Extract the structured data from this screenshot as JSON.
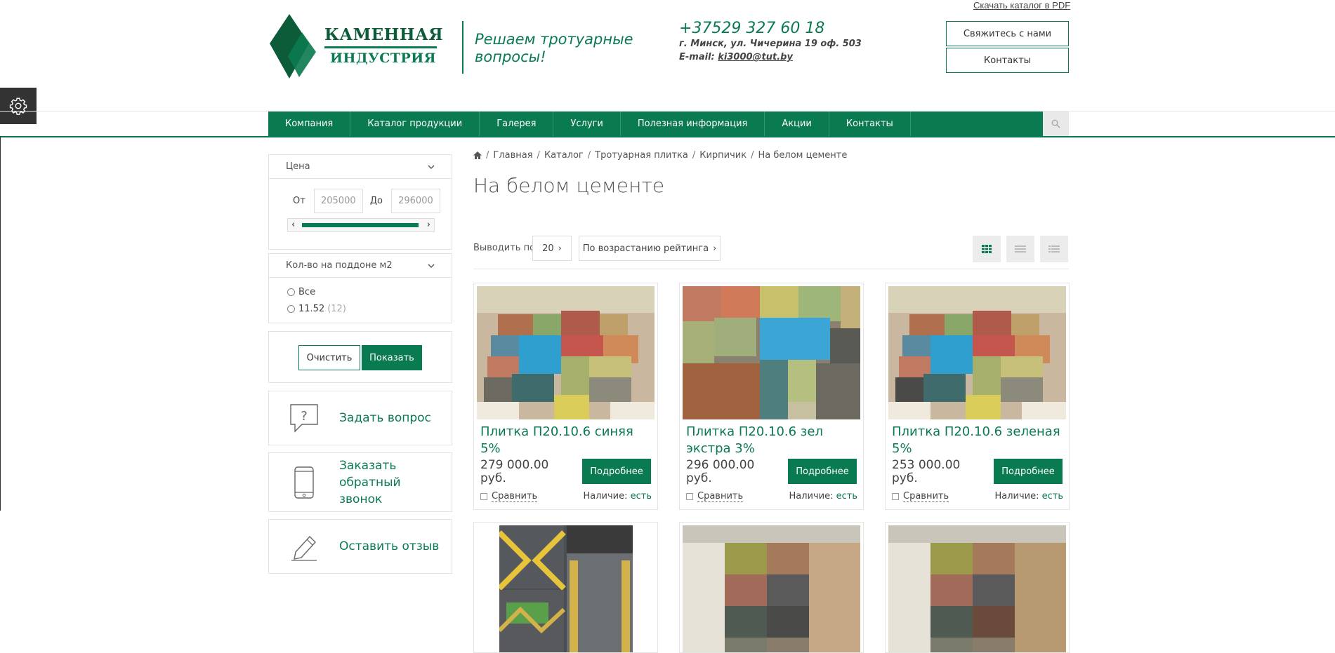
{
  "header": {
    "pdf_link": "Скачать каталог в PDF",
    "logo_line1": "КАМЕННАЯ",
    "logo_line2": "ИНДУСТРИЯ",
    "slogan": "Решаем тротуарные вопросы!",
    "phone": "+37529 327 60 18",
    "address": "г. Минск, ул. Чичерина 19 оф. 503",
    "email_label": "E-mail:",
    "email": "ki3000@tut.by",
    "contact_button": "Свяжитесь с нами",
    "contacts_button": "Контакты",
    "brand_color": "#0a7a50"
  },
  "nav": {
    "items": [
      "Компания",
      "Каталог продукции",
      "Галерея",
      "Услуги",
      "Полезная информация",
      "Акции",
      "Контакты"
    ]
  },
  "sidebar": {
    "price_title": "Цена",
    "from_label": "От",
    "from_placeholder": "205000",
    "to_label": "До",
    "to_placeholder": "296000",
    "pallet_title": "Кол-во на поддоне м2",
    "pallet_options": [
      {
        "label": "Все",
        "count": ""
      },
      {
        "label": "11.52",
        "count": "(12)"
      }
    ],
    "clear_button": "Очистить",
    "show_button": "Показать",
    "actions": [
      {
        "label": "Задать вопрос",
        "icon": "question-bubble-icon"
      },
      {
        "label": "Заказать обратный звонок",
        "icon": "phone-icon"
      },
      {
        "label": "Оставить отзыв",
        "icon": "pencil-icon"
      }
    ]
  },
  "main": {
    "breadcrumb": [
      "Главная",
      "Каталог",
      "Тротуарная плитка",
      "Кирпичик",
      "На белом цементе"
    ],
    "title": "На белом цементе",
    "per_page_label": "Выводить по:",
    "per_page_value": "20",
    "sort_value": "По возрастанию рейтинга",
    "products": [
      {
        "title": "Плитка П20.10.6 синяя 5%",
        "price": "279 000.00 руб.",
        "more": "Подробнее",
        "compare": "Сравнить",
        "stock_label": "Наличие:",
        "stock_value": "есть"
      },
      {
        "title": "Плитка П20.10.6 зел экстра 3%",
        "price": "296 000.00 руб.",
        "more": "Подробнее",
        "compare": "Сравнить",
        "stock_label": "Наличие:",
        "stock_value": "есть"
      },
      {
        "title": "Плитка П20.10.6 зеленая 5%",
        "price": "253 000.00 руб.",
        "more": "Подробнее",
        "compare": "Сравнить",
        "stock_label": "Наличие:",
        "stock_value": "есть"
      }
    ]
  }
}
